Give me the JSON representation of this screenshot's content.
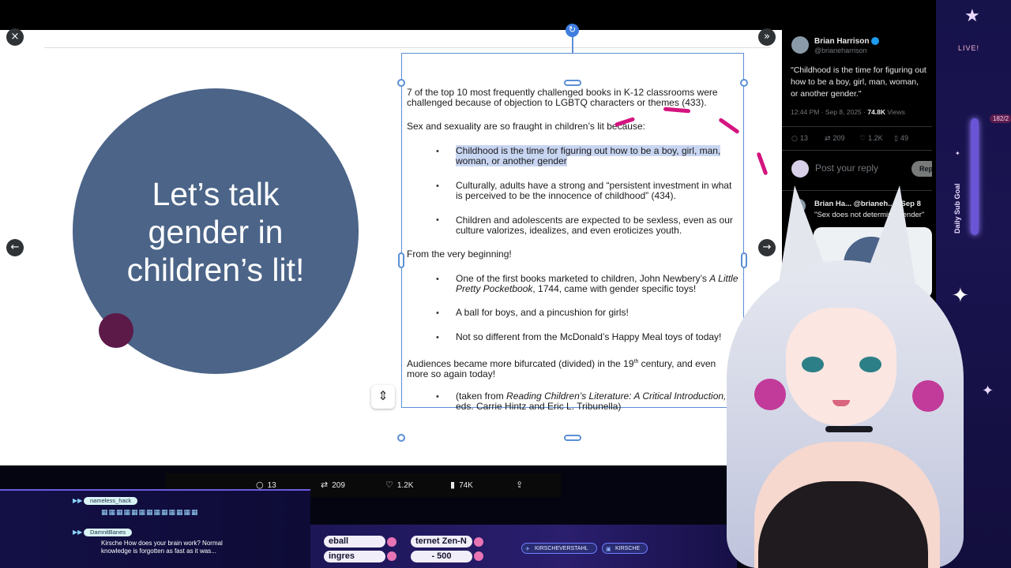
{
  "viewer": {
    "close_icon": "×",
    "expand_icon": "»",
    "prev_icon": "←",
    "next_icon": "→",
    "rotate_icon": "↻",
    "slide_tool_icon": "⇕"
  },
  "slide": {
    "title_line1": "Let’s talk",
    "title_line2": "gender in",
    "title_line3": "children’s lit!",
    "colors": {
      "circle": "#4b6488",
      "dot": "#5c1a48",
      "highlight": "#c9d6f2",
      "ink": "#d4147f"
    }
  },
  "textbox": {
    "p1": "7 of the top 10 most frequently challenged books in K-12 classrooms were challenged because of objection to LGBTQ characters or themes (433).",
    "p2": "Sex and sexuality are so fraught in children’s lit because:",
    "bullets_a": [
      "Childhood is the time for figuring out how to be a boy, girl, man, woman, or another gender",
      "Culturally, adults have a strong  and “persistent investment in what is perceived to be the innocence of childhood” (434).",
      "Children and adolescents are expected to be sexless, even as our culture valorizes, idealizes, and even eroticizes youth."
    ],
    "p3": "From the very beginning!",
    "b4_pre": "One of the first books marketed to children, John Newbery’s ",
    "b4_em": "A Little Pretty Pocketbook",
    "b4_post": ", 1744, came with gender specific toys!",
    "b5": "A ball for boys, and a pincushion for girls!",
    "b6": "Not so different from the McDonald’s Happy Meal toys of today!",
    "p4_pre": "Audiences became more bifurcated (divided) in the 19",
    "p4_sup": "th",
    "p4_post": " century, and even more so again today!",
    "b7_pre": "(taken from ",
    "b7_em": "Reading Children’s Literature: A Critical Introduction,",
    "b7_post": " eds. Carrie Hintz and Eric L. Tribunella)",
    "bullet_glyph": "•"
  },
  "actions": {
    "reply_icon": "○",
    "reply_count": "13",
    "retweet_icon": "⇄",
    "retweet_count": "209",
    "like_icon": "♡",
    "like_count": "1.2K",
    "views_icon": "▮",
    "views_count": "74K",
    "share_icon": "⇪"
  },
  "x_panel": {
    "author_name": "Brian Harrison",
    "author_handle": "@brianeharrison",
    "tweet_text": "\"Childhood is the time for figuring out how to be a boy, girl, man, woman, or another gender.\"",
    "time": "12:44 PM · Sep 8, 2025 · ",
    "views": "74.8K",
    "views_label": " Views",
    "stats": {
      "reply": "13",
      "retweet": "209",
      "like": "1.2K",
      "bookmark": "49"
    },
    "reply_placeholder": "Post your reply",
    "reply_button": "Reply",
    "reply_author": "Brian Ha... @brianeh... · Sep 8",
    "reply_text": "\"Sex does not determine gender\""
  },
  "stream": {
    "live_label": "LIVE!",
    "goal_label": "Daily Sub Goal",
    "goal_count": "182/2",
    "chat": [
      {
        "user": "nameless_hack",
        "msg": ""
      },
      {
        "user": "DamnitBanes",
        "msg_line1": "Kirsche How does your brain work? Normal",
        "msg_line2": "knowledge is forgotten as fast as it was..."
      }
    ],
    "emotes": "▦▦▦▦▦▦▦▦▦▦▦▦▦",
    "ticker": {
      "p1": "eball",
      "p2": "ternet Zen-N",
      "p3": "ingres",
      "p4": "- 500"
    },
    "socials": [
      {
        "icon": "✈",
        "label": "KIRSCHEVERSTAHL"
      },
      {
        "icon": "▣",
        "label": "KIRSCHE"
      }
    ]
  }
}
